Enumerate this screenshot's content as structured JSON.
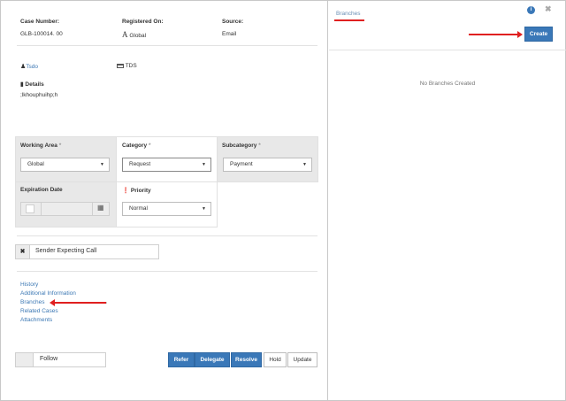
{
  "case_info": {
    "case_number_label": "Case Number:",
    "case_number_value": "GLB-100014. 00",
    "registered_label": "Registered On:",
    "registered_value": "Global",
    "source_label": "Source:",
    "source_value": "Email"
  },
  "meta": {
    "user_link": "Tsdo",
    "tds_label": "TDS",
    "details_label": "Details",
    "details_value": ";lkhouphuihp;h"
  },
  "form": {
    "working_area_label": "Working Area",
    "working_area_value": "Global",
    "category_label": "Category",
    "category_value": "Request",
    "subcategory_label": "Subcategory",
    "subcategory_value": "Payment",
    "expiration_label": "Expiration Date",
    "priority_label": "Priority",
    "priority_value": "Normal",
    "required_mark": "*"
  },
  "tag": {
    "text": "Sender Expecting Call"
  },
  "links": [
    "History",
    "Additional Information",
    "Branches",
    "Related Cases",
    "Attachments"
  ],
  "footer": {
    "follow_label": "Follow",
    "refer": "Refer",
    "delegate": "Delegate",
    "resolve": "Resolve",
    "hold": "Hold",
    "update": "Update"
  },
  "panel": {
    "title": "Branches",
    "create_button": "Create",
    "empty_message": "No Branches Created"
  },
  "colors": {
    "accent": "#3a78b8",
    "annotation": "#e02020"
  }
}
